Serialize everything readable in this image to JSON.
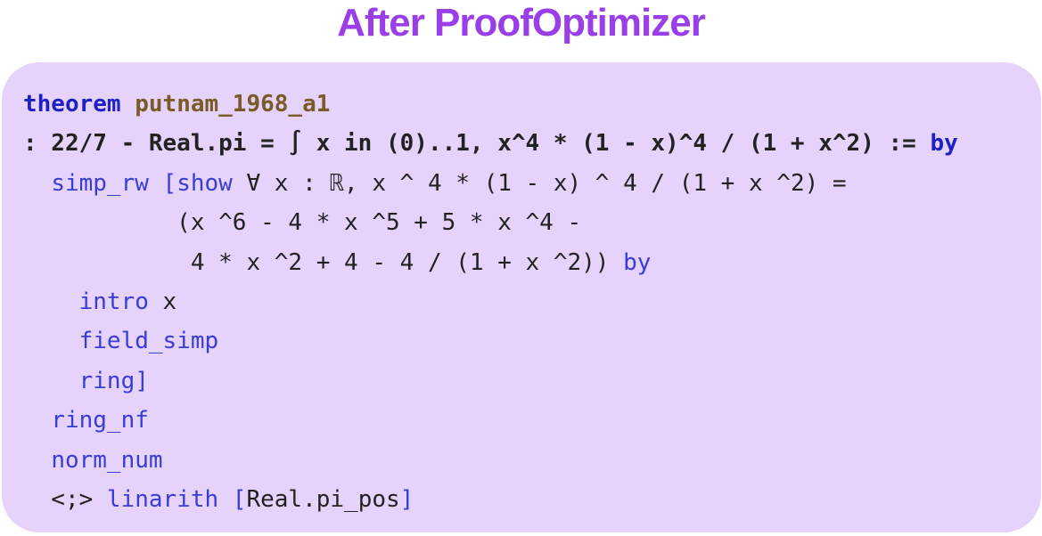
{
  "title": "After ProofOptimizer",
  "colors": {
    "title": "#9a3ee8",
    "panel_background": "#e6d3fb",
    "text": "#222222",
    "keyword": "#1f1fc6",
    "theorem_name": "#7a5a26",
    "tactic": "#3b3bd6"
  },
  "code": {
    "lines": [
      {
        "bold": true,
        "tokens": [
          {
            "text": "theorem",
            "kind": "keyword"
          },
          {
            "text": " ",
            "kind": "plain"
          },
          {
            "text": "putnam_1968_a1",
            "kind": "name"
          }
        ]
      },
      {
        "bold": true,
        "tokens": [
          {
            "text": ": 22/7 - Real.pi = ∫ x in (0)..1, x^4 * (1 - x)^4 / (1 + x^2) := ",
            "kind": "plain"
          },
          {
            "text": "by",
            "kind": "keyword"
          }
        ]
      },
      {
        "bold": false,
        "tokens": [
          {
            "text": "  ",
            "kind": "plain"
          },
          {
            "text": "simp_rw [show",
            "kind": "tactic"
          },
          {
            "text": " ∀ x : ℝ, x ^ 4 * (1 - x) ^ 4 / (1 + x ^2) =",
            "kind": "plain"
          }
        ]
      },
      {
        "bold": false,
        "tokens": [
          {
            "text": "           (x ^6 - 4 * x ^5 + 5 * x ^4 -",
            "kind": "plain"
          }
        ]
      },
      {
        "bold": false,
        "tokens": [
          {
            "text": "            4 * x ^2 + 4 - 4 / (1 + x ^2)) ",
            "kind": "plain"
          },
          {
            "text": "by",
            "kind": "tactic"
          }
        ]
      },
      {
        "bold": false,
        "tokens": [
          {
            "text": "    ",
            "kind": "plain"
          },
          {
            "text": "intro",
            "kind": "tactic"
          },
          {
            "text": " x",
            "kind": "plain"
          }
        ]
      },
      {
        "bold": false,
        "tokens": [
          {
            "text": "    ",
            "kind": "plain"
          },
          {
            "text": "field_simp",
            "kind": "tactic"
          }
        ]
      },
      {
        "bold": false,
        "tokens": [
          {
            "text": "    ",
            "kind": "plain"
          },
          {
            "text": "ring]",
            "kind": "tactic"
          }
        ]
      },
      {
        "bold": false,
        "tokens": [
          {
            "text": "  ",
            "kind": "plain"
          },
          {
            "text": "ring_nf",
            "kind": "tactic"
          }
        ]
      },
      {
        "bold": false,
        "tokens": [
          {
            "text": "  ",
            "kind": "plain"
          },
          {
            "text": "norm_num",
            "kind": "tactic"
          }
        ]
      },
      {
        "bold": false,
        "tokens": [
          {
            "text": "  <;> ",
            "kind": "plain"
          },
          {
            "text": "linarith [",
            "kind": "tactic"
          },
          {
            "text": "Real.pi_pos",
            "kind": "plain"
          },
          {
            "text": "]",
            "kind": "tactic"
          }
        ]
      }
    ]
  }
}
